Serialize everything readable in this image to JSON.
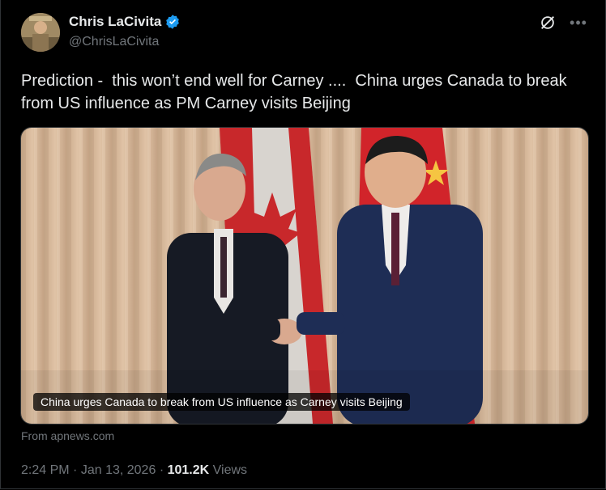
{
  "author": {
    "display_name": "Chris LaCivita",
    "handle": "@ChrisLaCivita",
    "verified_icon": "verified-badge-icon"
  },
  "tweet": {
    "text": "Prediction -  this won’t end well for Carney ....  China urges Canada to break from US influence as PM Carney visits Beijing"
  },
  "media": {
    "caption": "China urges Canada to break from US influence as Carney visits Beijing",
    "source": "From apnews.com"
  },
  "meta": {
    "time": "2:24 PM",
    "separator": "·",
    "date": "Jan 13, 2026",
    "separator2": "·",
    "views_count": "101.2K",
    "views_label": "Views"
  },
  "colors": {
    "background": "#000000",
    "text": "#e7e9ea",
    "muted": "#71767b",
    "verified": "#1d9bf0"
  },
  "icons": [
    "grok-icon",
    "more-icon"
  ]
}
